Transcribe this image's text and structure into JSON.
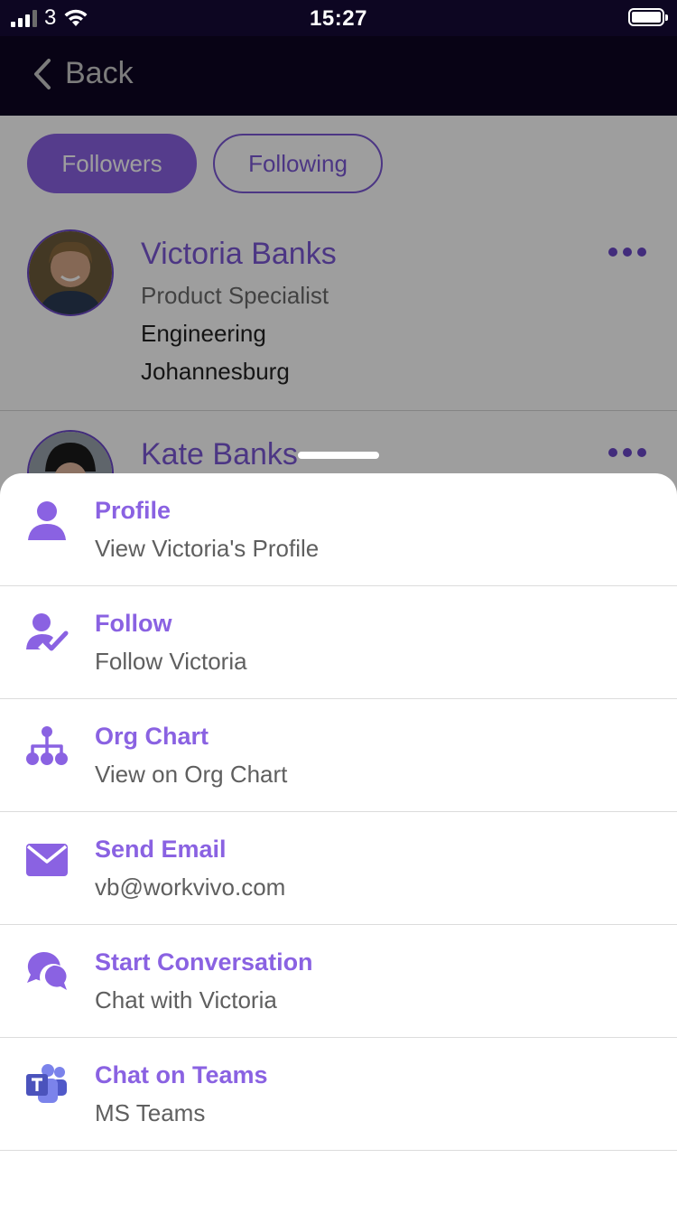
{
  "status_bar": {
    "carrier": "3",
    "time": "15:27"
  },
  "nav": {
    "back_label": "Back"
  },
  "tabs": [
    {
      "label": "Followers",
      "active": true
    },
    {
      "label": "Following",
      "active": false
    }
  ],
  "people": [
    {
      "name": "Victoria Banks",
      "role": "Product Specialist",
      "department": "Engineering",
      "location": "Johannesburg"
    },
    {
      "name": "Kate Banks"
    }
  ],
  "sheet": {
    "actions": [
      {
        "title": "Profile",
        "subtitle": "View Victoria's Profile",
        "icon": "person-icon"
      },
      {
        "title": "Follow",
        "subtitle": "Follow Victoria",
        "icon": "person-check-icon"
      },
      {
        "title": "Org Chart",
        "subtitle": "View on Org Chart",
        "icon": "org-chart-icon"
      },
      {
        "title": "Send Email",
        "subtitle": "vb@workvivo.com",
        "icon": "envelope-icon"
      },
      {
        "title": "Start Conversation",
        "subtitle": "Chat with Victoria",
        "icon": "chat-bubbles-icon"
      },
      {
        "title": "Chat on Teams",
        "subtitle": "MS Teams",
        "icon": "ms-teams-icon"
      }
    ]
  },
  "colors": {
    "accent": "#8a62e2",
    "nav_bg": "#0d0622",
    "teams": "#5b5fc7"
  }
}
